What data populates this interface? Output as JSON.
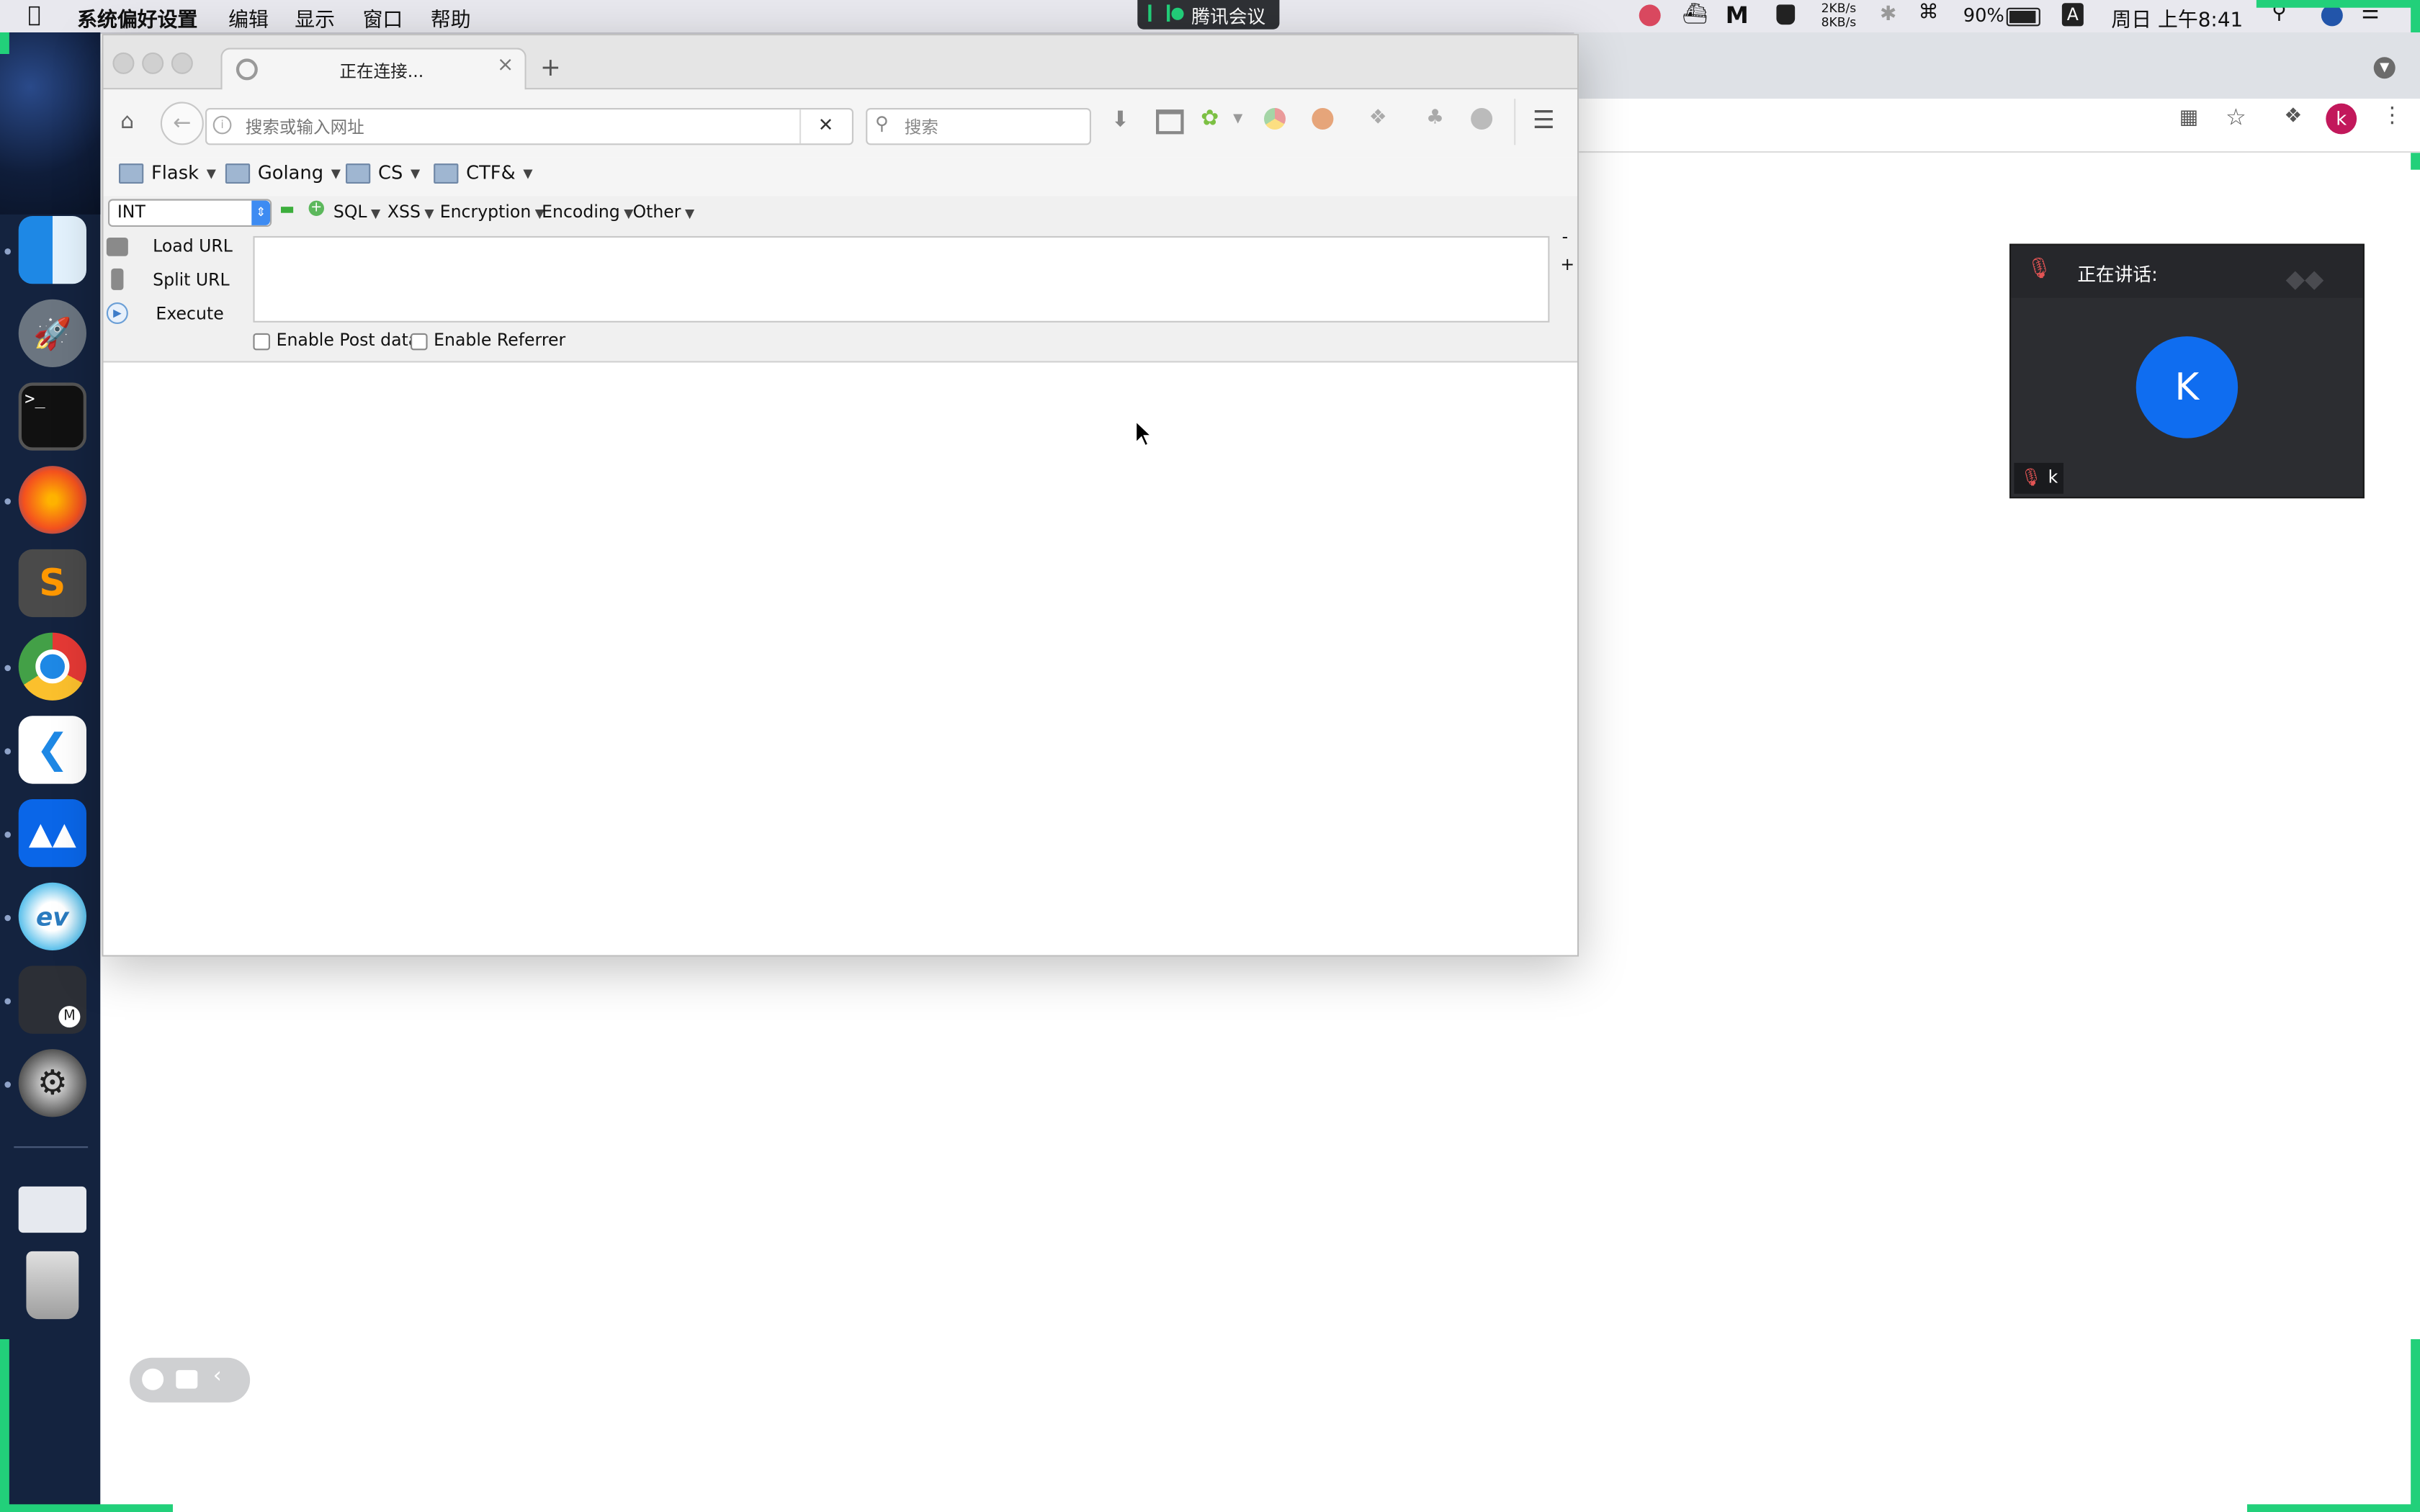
{
  "menubar": {
    "apple_icon": "apple-icon",
    "app_name": "系统偏好设置",
    "menus": [
      "编辑",
      "显示",
      "窗口",
      "帮助"
    ],
    "network_up": "2KB/s",
    "network_down": "8KB/s",
    "battery": "90%",
    "input_method": "A",
    "clock": "周日 上午8:41"
  },
  "tencent_meeting_pill": {
    "label": "腾讯会议"
  },
  "firefox": {
    "tab_title": "正在连接...",
    "tab_close": "×",
    "new_tab": "+",
    "url_placeholder": "搜索或输入网址",
    "search_placeholder": "搜索",
    "clear_url": "✕",
    "bookmarks": [
      "Flask",
      "Golang",
      "CS",
      "CTF&"
    ],
    "hackbar": {
      "select_value": "INT",
      "menus": [
        "SQL",
        "XSS",
        "Encryption",
        "Encoding",
        "Other"
      ],
      "buttons": [
        "Load URL",
        "Split URL",
        "Execute"
      ],
      "minus": "-",
      "plus": "+",
      "checkboxes": [
        "Enable Post data",
        "Enable Referrer"
      ]
    }
  },
  "chrome_bg": {
    "profile_letter": "k"
  },
  "meeting": {
    "speaking_label": "正在讲话:",
    "avatar_letter": "K",
    "user_name": "k"
  },
  "colors": {
    "accent_green": "#22d07a",
    "meeting_blue": "#0f6df0"
  }
}
